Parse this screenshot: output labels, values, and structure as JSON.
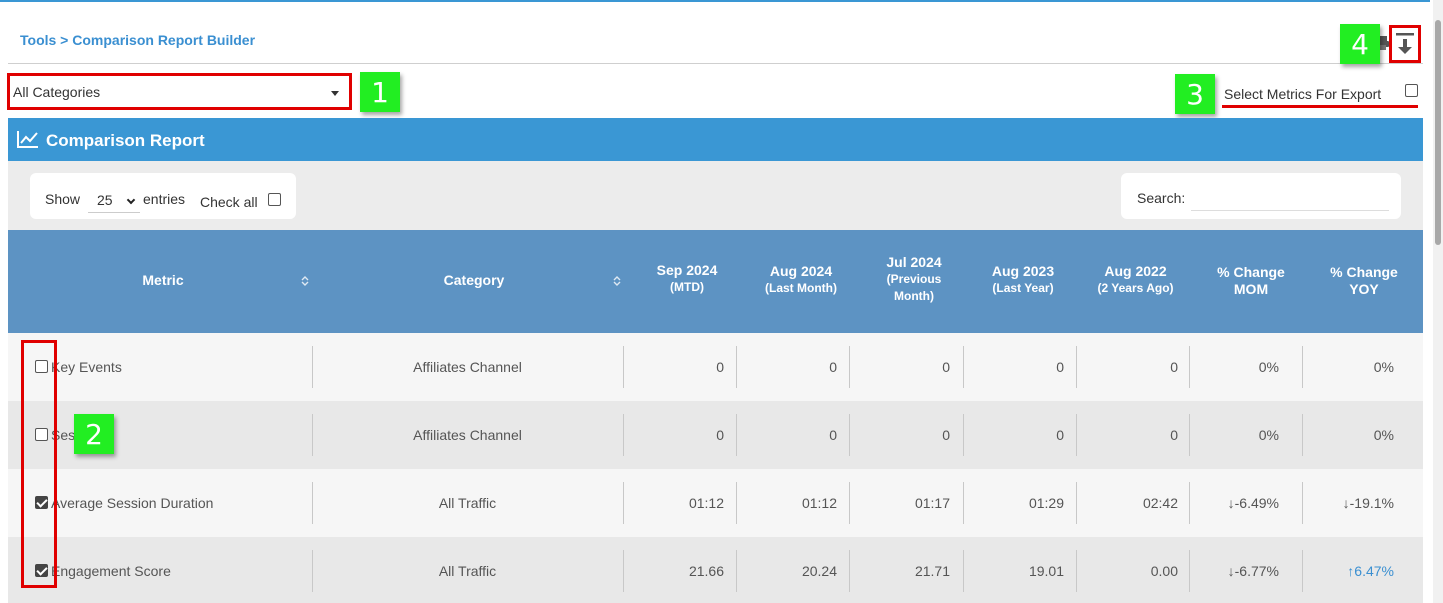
{
  "breadcrumb": "Tools > Comparison Report Builder",
  "category_select": {
    "value": "All Categories"
  },
  "export": {
    "label": "Select Metrics For Export",
    "checked": false
  },
  "badges": [
    "1",
    "2",
    "3",
    "4"
  ],
  "panel": {
    "title": "Comparison Report"
  },
  "controls": {
    "show_label": "Show",
    "page_length": "25",
    "entries_label": "entries",
    "check_all_label": "Check all",
    "search_label": "Search:"
  },
  "table": {
    "headers": {
      "metric": "Metric",
      "category": "Category",
      "sep2024": {
        "main": "Sep 2024",
        "sub": "(MTD)"
      },
      "aug2024": {
        "main": "Aug 2024",
        "sub": "(Last Month)"
      },
      "jul2024": {
        "main": "Jul 2024",
        "sub1": "(Previous",
        "sub2": "Month)"
      },
      "aug2023": {
        "main": "Aug 2023",
        "sub": "(Last Year)"
      },
      "aug2022": {
        "main": "Aug 2022",
        "sub": "(2 Years Ago)"
      },
      "mom": {
        "line1": "% Change",
        "line2": "MOM"
      },
      "yoy": {
        "line1": "% Change",
        "line2": "YOY"
      }
    },
    "rows": [
      {
        "checked": false,
        "metric": "Key Events",
        "category": "Affiliates Channel",
        "sep2024": "0",
        "aug2024": "0",
        "jul2024": "0",
        "aug2023": "0",
        "aug2022": "0",
        "mom": "0%",
        "yoy": "0%"
      },
      {
        "checked": false,
        "metric": "Ses",
        "category": "Affiliates Channel",
        "sep2024": "0",
        "aug2024": "0",
        "jul2024": "0",
        "aug2023": "0",
        "aug2022": "0",
        "mom": "0%",
        "yoy": "0%"
      },
      {
        "checked": true,
        "metric": "Average Session Duration",
        "category": "All Traffic",
        "sep2024": "01:12",
        "aug2024": "01:12",
        "jul2024": "01:17",
        "aug2023": "01:29",
        "aug2022": "02:42",
        "mom": "↓-6.49%",
        "yoy": "↓-19.1%"
      },
      {
        "checked": true,
        "metric": "Engagement Score",
        "category": "All Traffic",
        "sep2024": "21.66",
        "aug2024": "20.24",
        "jul2024": "21.71",
        "aug2023": "19.01",
        "aug2022": "0.00",
        "mom": "↓-6.77%",
        "yoy": "↑6.47%"
      }
    ]
  },
  "colors": {
    "accent": "#3a97d4",
    "table_header": "#5d93c3",
    "annotation_red": "#e00000",
    "badge_green": "#22ee22",
    "up_blue": "#3a8fd1"
  }
}
